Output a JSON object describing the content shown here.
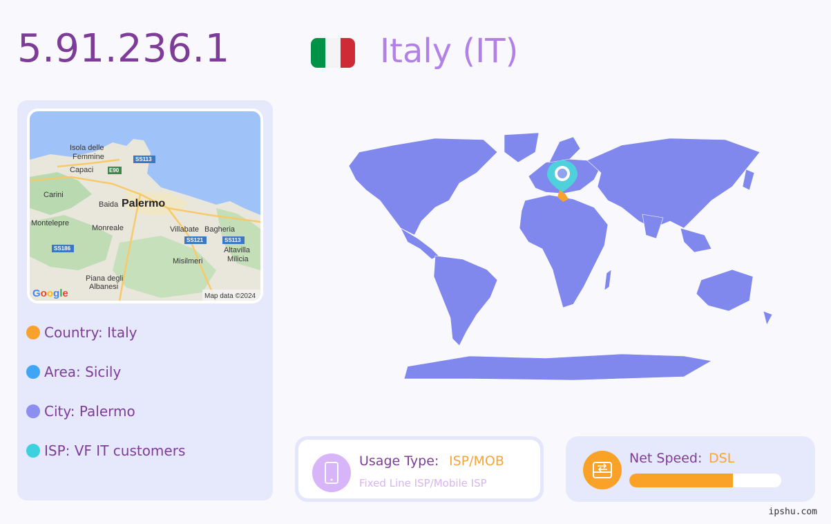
{
  "header": {
    "ip": "5.91.236.1",
    "country_title": "Italy (IT)",
    "flag_colors": [
      "#009246",
      "#ffffff",
      "#ce2b37"
    ]
  },
  "mini_map": {
    "labels": [
      "Isola delle",
      "Femmine",
      "Capaci",
      "Carini",
      "Baida",
      "Palermo",
      "Montelepre",
      "Monreale",
      "Villabate",
      "Bagheria",
      "Altavilla",
      "Milicia",
      "Misilmeri",
      "Piana degli",
      "Albanesi"
    ],
    "roads": [
      "SS113",
      "E90",
      "SS121",
      "SS113",
      "SS186"
    ],
    "logo": "Google",
    "attribution": "Map data ©2024"
  },
  "info": {
    "country": "Country: Italy",
    "area": "Area: Sicily",
    "city": "City: Palermo",
    "isp": "ISP: VF IT customers"
  },
  "usage": {
    "label": "Usage Type:",
    "value": "ISP/MOB",
    "description": "Fixed Line ISP/Mobile ISP"
  },
  "speed": {
    "label": "Net Speed:",
    "value": "DSL",
    "level_percent": 68
  },
  "footer": {
    "site": "ipshu.com"
  },
  "colors": {
    "country_dot": "#f7a22f",
    "area_dot": "#3fa6f6",
    "city_dot": "#8c8ef0",
    "isp_dot": "#3dd0de",
    "map_land": "#8088ee",
    "marker": "#4fd1dc"
  }
}
